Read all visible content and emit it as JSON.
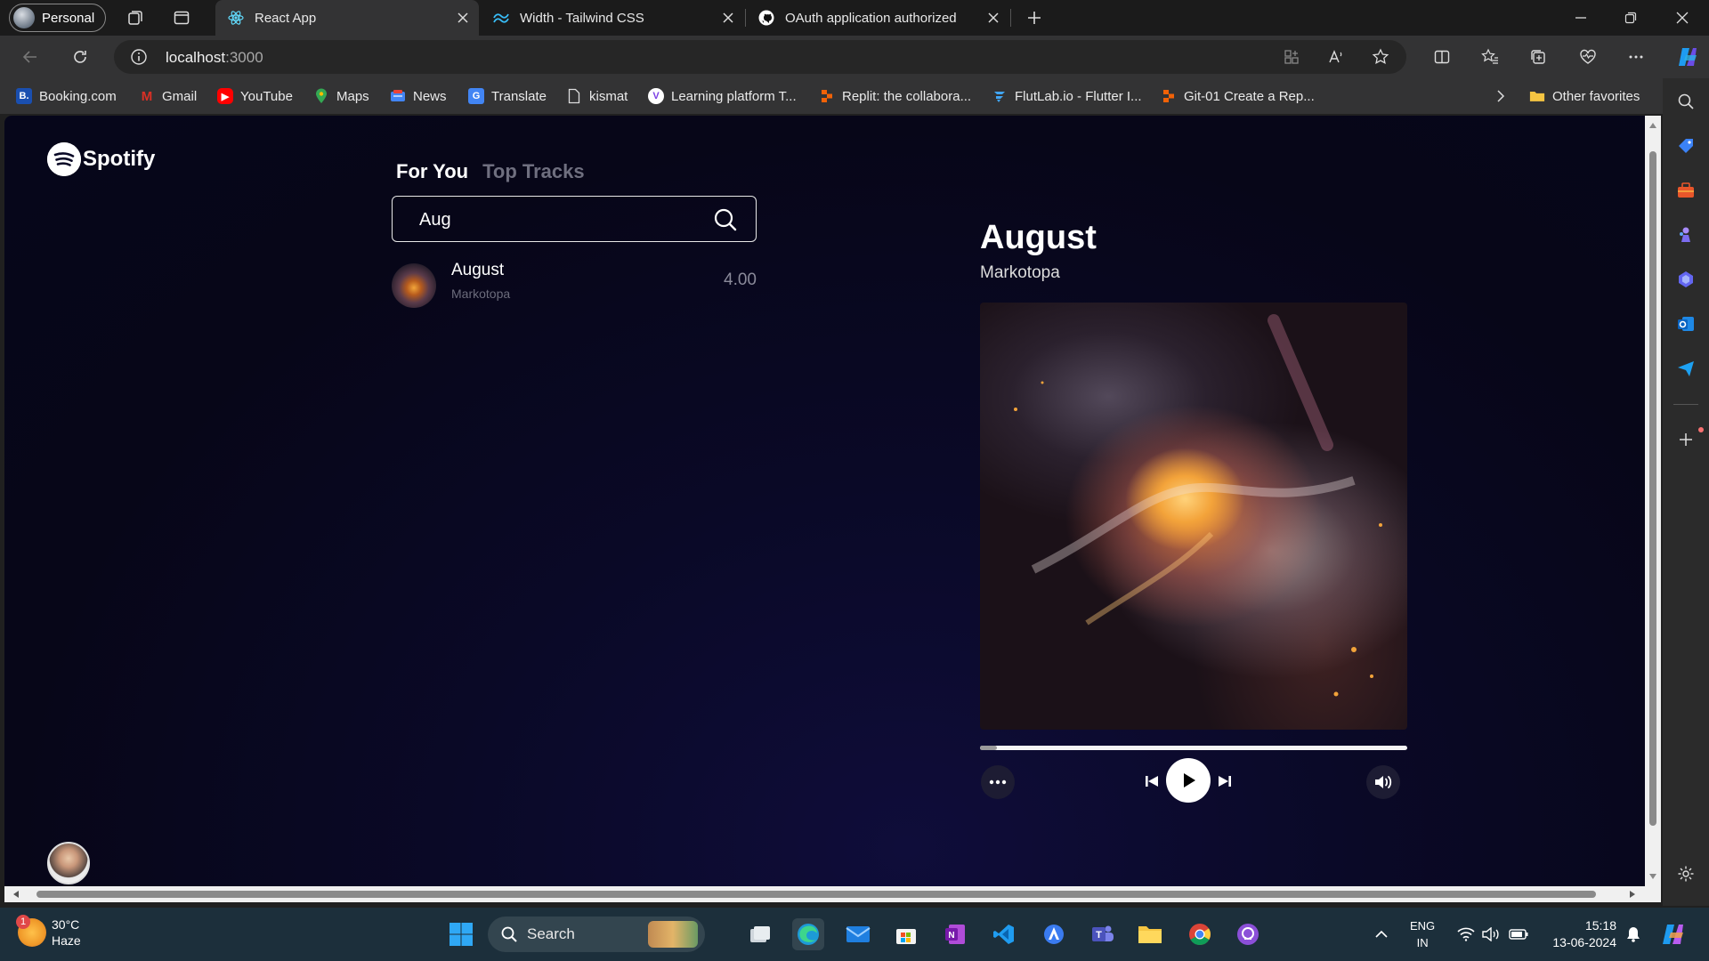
{
  "browser": {
    "profile_label": "Personal",
    "tabs": [
      {
        "title": "React App",
        "active": true
      },
      {
        "title": "Width - Tailwind CSS",
        "active": false
      },
      {
        "title": "OAuth application authorized",
        "active": false
      }
    ],
    "address": {
      "host": "localhost",
      "port": ":3000"
    },
    "favorites": [
      {
        "label": "Booking.com",
        "icon": "booking-icon",
        "color": "#1a4fb0"
      },
      {
        "label": "Gmail",
        "icon": "gmail-icon",
        "color": "#d93025"
      },
      {
        "label": "YouTube",
        "icon": "youtube-icon",
        "color": "#ff0000"
      },
      {
        "label": "Maps",
        "icon": "maps-icon",
        "color": "#34a853"
      },
      {
        "label": "News",
        "icon": "news-icon",
        "color": "#4285f4"
      },
      {
        "label": "Translate",
        "icon": "translate-icon",
        "color": "#4285f4"
      },
      {
        "label": "kismat",
        "icon": "page-icon",
        "color": "#9a9a9a"
      },
      {
        "label": "Learning platform T...",
        "icon": "learning-icon",
        "color": "#7b3fe4"
      },
      {
        "label": "Replit: the collabora...",
        "icon": "replit-icon",
        "color": "#f26207"
      },
      {
        "label": "FlutLab.io - Flutter I...",
        "icon": "flutlab-icon",
        "color": "#41a6f5"
      },
      {
        "label": "Git-01 Create a Rep...",
        "icon": "replit-icon",
        "color": "#f26207"
      }
    ],
    "other_favorites_label": "Other favorites"
  },
  "app": {
    "brand": "Spotify",
    "nav": {
      "for_you": "For You",
      "top_tracks": "Top Tracks"
    },
    "search": {
      "value": "Aug"
    },
    "results": [
      {
        "title": "August",
        "artist": "Markotopa",
        "duration": "4.00"
      }
    ],
    "now_playing": {
      "title": "August",
      "artist": "Markotopa",
      "progress": 0.04
    },
    "colors": {
      "accent": "#ffffff",
      "background": "#070618"
    }
  },
  "taskbar": {
    "weather": {
      "temp": "30°C",
      "condition": "Haze",
      "badge": "1"
    },
    "search_label": "Search",
    "language": {
      "line1": "ENG",
      "line2": "IN"
    },
    "clock": {
      "time": "15:18",
      "date": "13-06-2024"
    }
  }
}
